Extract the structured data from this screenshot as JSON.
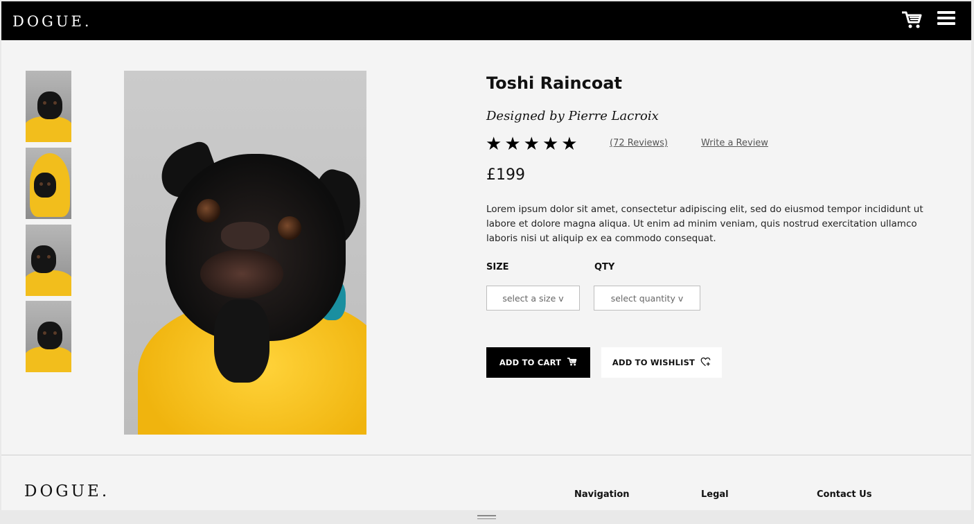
{
  "header": {
    "logo": "DOGUE.",
    "cart_icon": "cart-icon",
    "menu_icon": "hamburger-menu-icon"
  },
  "gallery": {
    "thumbnails": [
      "thumbnail-1",
      "thumbnail-2",
      "thumbnail-3",
      "thumbnail-4"
    ]
  },
  "product": {
    "title": "Toshi Raincoat",
    "designer": "Designed by Pierre Lacroix",
    "rating_stars": 5,
    "reviews": "(72 Reviews)",
    "write_review": "Write a Review",
    "price": "£199",
    "description": "Lorem ipsum dolor sit amet, consectetur adipiscing elit, sed do eiusmod tempor incididunt ut labore et dolore magna aliqua. Ut enim ad minim veniam, quis nostrud exercitation ullamco laboris nisi ut aliquip ex ea commodo consequat.",
    "size_label": "SIZE",
    "qty_label": "QTY",
    "size_select": "select a size v",
    "qty_select": "select quantity v",
    "add_to_cart": "ADD TO CART",
    "add_to_wishlist": "ADD TO WISHLIST"
  },
  "footer": {
    "logo": "DOGUE.",
    "navigation": "Navigation",
    "legal": "Legal",
    "contact": "Contact Us"
  },
  "colors": {
    "header_bg": "#000000",
    "page_bg": "#f4f4f4",
    "coat_yellow": "#f2be1c"
  }
}
